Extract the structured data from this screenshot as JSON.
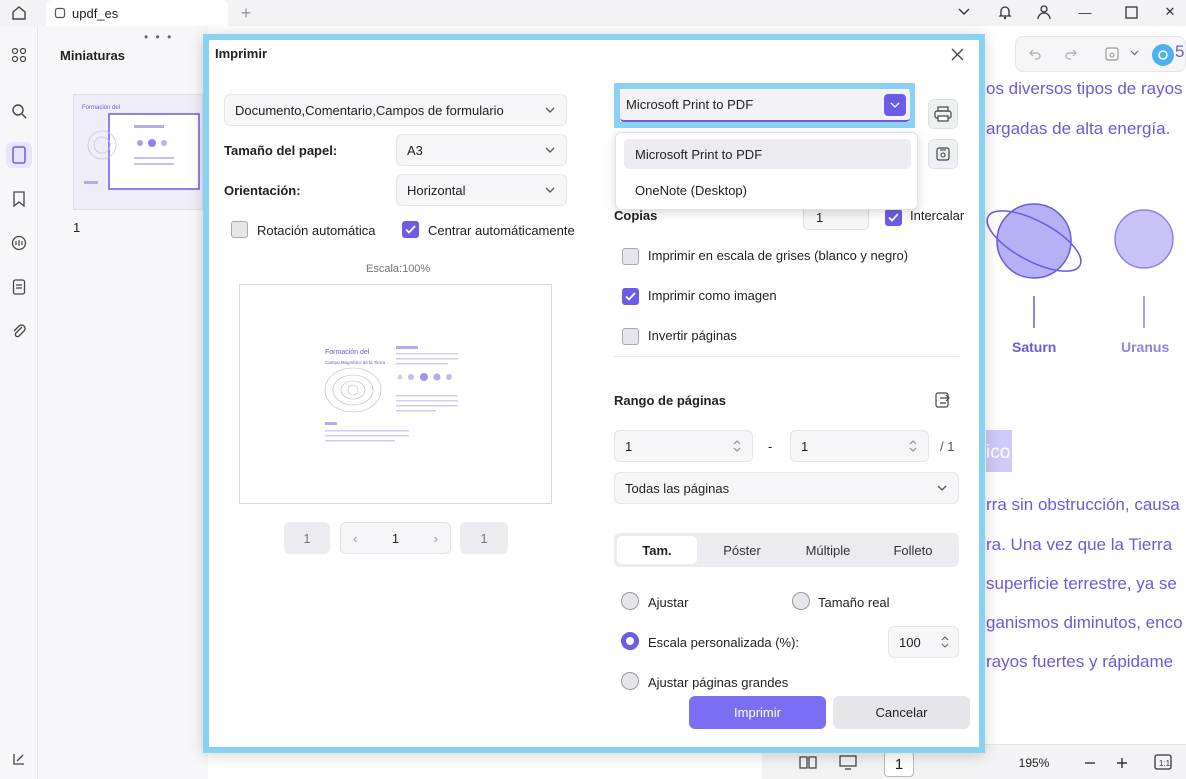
{
  "app": {
    "tab_title": "updf_es",
    "win_minimize": "—",
    "win_close": "✕"
  },
  "thumbnails": {
    "title": "Miniaturas",
    "handle": "• • •",
    "page_num": "1"
  },
  "document": {
    "lines": [
      "os diversos tipos de rayos",
      "argadas de alta energía.",
      "rra sin obstrucción, causa",
      "ra. Una vez que la Tierra",
      "superficie terrestre, ya se",
      "ganismos diminutos, enco",
      "rayos fuertes y rápidame"
    ],
    "snippet_top": "5",
    "heading_fragment": "ico",
    "planets": [
      "Saturn",
      "Uranus"
    ],
    "bottom_page": "1",
    "zoom": "195%"
  },
  "dialog": {
    "title": "Imprimir",
    "content_select": "Documento,Comentario,Campos de formulario",
    "paper_label": "Tamaño del papel:",
    "paper_value": "A3",
    "orientation_label": "Orientación:",
    "orientation_value": "Horizontal",
    "auto_rotate": "Rotación automática",
    "auto_center": "Centrar automáticamente",
    "scale_caption": "Escala:100%",
    "pager": {
      "first": "1",
      "current": "1",
      "last": "1"
    },
    "printer": {
      "selected": "Microsoft Print to PDF",
      "options": [
        "Microsoft Print to PDF",
        "OneNote (Desktop)"
      ]
    },
    "copies_label": "Copias",
    "copies_value": "1",
    "collate": "Intercalar",
    "grayscale": "Imprimir en escala de grises (blanco y negro)",
    "as_image": "Imprimir como imagen",
    "reverse": "Invertir páginas",
    "range_label": "Rango de páginas",
    "range_from": "1",
    "range_to": "1",
    "range_dash": "-",
    "range_total": "/ 1",
    "range_mode": "Todas las páginas",
    "tabs": [
      "Tam.",
      "Póster",
      "Múltiple",
      "Folleto"
    ],
    "fit": "Ajustar",
    "actual_size": "Tamaño real",
    "custom_scale": "Escala personalizada (%):",
    "custom_scale_value": "100",
    "fit_large": "Ajustar páginas grandes",
    "print_btn": "Imprimir",
    "cancel_btn": "Cancelar"
  },
  "preview_doc": {
    "title_line1": "Formación del",
    "title_line2": "Campo Magnético de la Tierra"
  },
  "colors": {
    "accent": "#6c5ce7",
    "highlight": "#8ad1f3",
    "doc_text": "#6b5cd6"
  }
}
